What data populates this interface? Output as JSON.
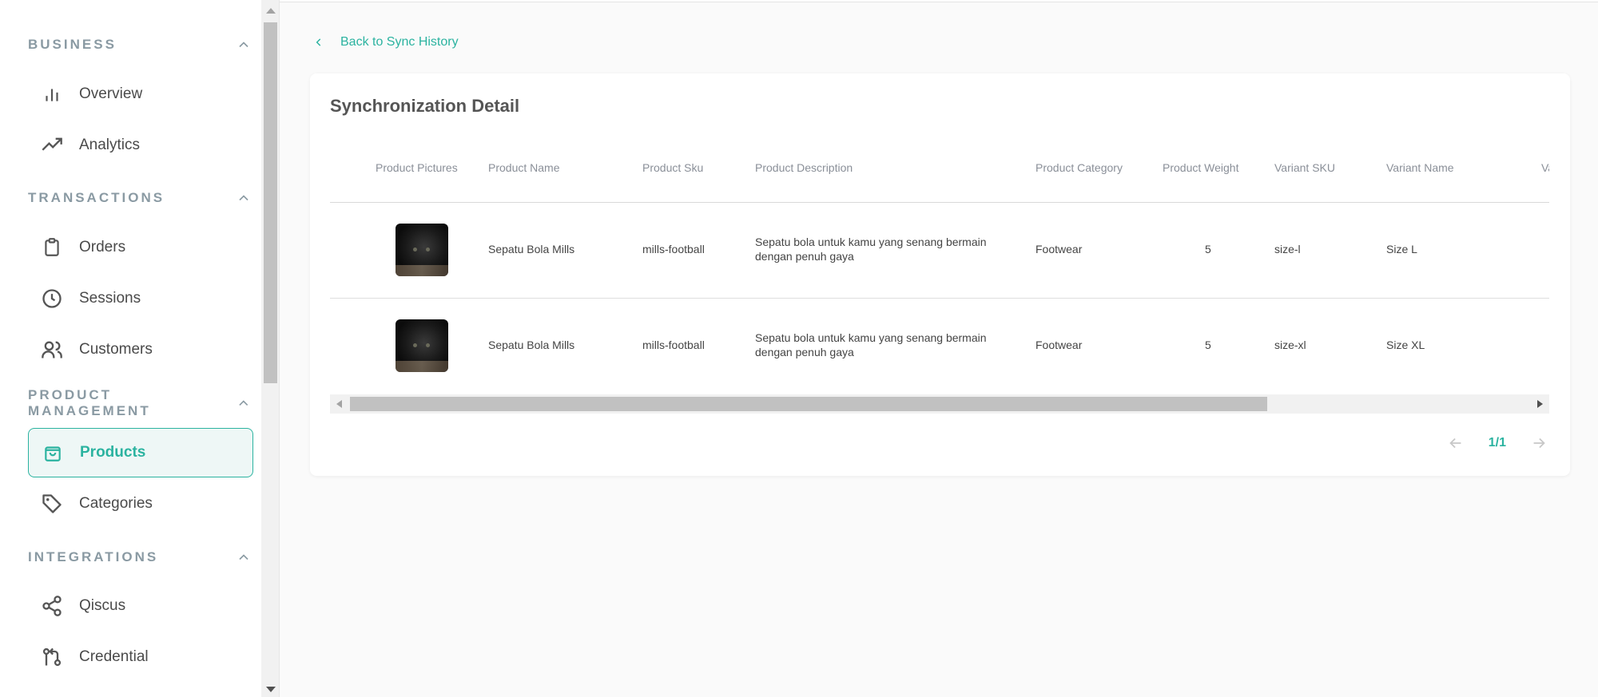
{
  "sidebar": {
    "sections": [
      {
        "title": "BUSINESS",
        "items": [
          {
            "label": "Overview",
            "icon": "bar-chart-icon"
          },
          {
            "label": "Analytics",
            "icon": "trending-up-icon"
          }
        ]
      },
      {
        "title": "TRANSACTIONS",
        "items": [
          {
            "label": "Orders",
            "icon": "clipboard-icon"
          },
          {
            "label": "Sessions",
            "icon": "clock-icon"
          },
          {
            "label": "Customers",
            "icon": "users-icon"
          }
        ]
      },
      {
        "title": "PRODUCT MANAGEMENT",
        "items": [
          {
            "label": "Products",
            "icon": "shopping-bag-icon",
            "active": true
          },
          {
            "label": "Categories",
            "icon": "tag-icon"
          }
        ]
      },
      {
        "title": "INTEGRATIONS",
        "items": [
          {
            "label": "Qiscus",
            "icon": "share-icon"
          },
          {
            "label": "Credential",
            "icon": "git-pull-request-icon"
          }
        ]
      }
    ]
  },
  "main": {
    "back_link": "Back to Sync History",
    "title": "Synchronization Detail",
    "columns": [
      "Product Pictures",
      "Product Name",
      "Product Sku",
      "Product Description",
      "Product Category",
      "Product Weight",
      "Variant SKU",
      "Variant Name",
      "Va"
    ],
    "rows": [
      {
        "name": "Sepatu Bola Mills",
        "sku": "mills-football",
        "description": "Sepatu bola untuk kamu yang senang bermain dengan penuh gaya",
        "category": "Footwear",
        "weight": "5",
        "variant_sku": "size-l",
        "variant_name": "Size L"
      },
      {
        "name": "Sepatu Bola Mills",
        "sku": "mills-football",
        "description": "Sepatu bola untuk kamu yang senang bermain dengan penuh gaya",
        "category": "Footwear",
        "weight": "5",
        "variant_sku": "size-xl",
        "variant_name": "Size XL"
      }
    ],
    "pagination": "1/1"
  },
  "colors": {
    "accent": "#2bb3a0",
    "muted": "#8a9aa3"
  }
}
